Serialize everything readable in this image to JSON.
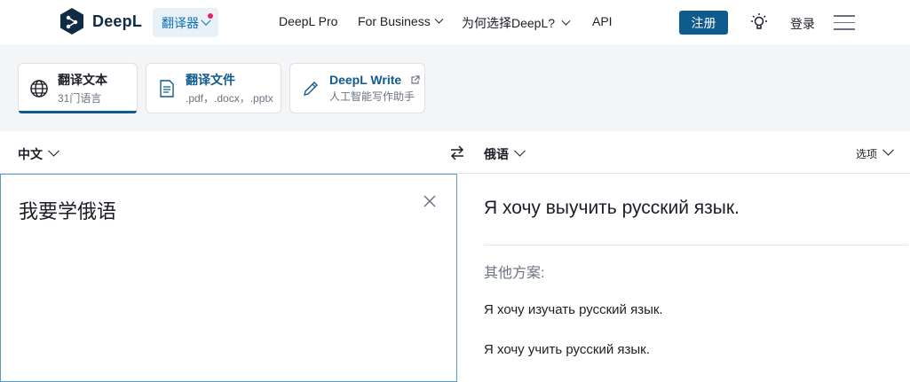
{
  "header": {
    "logo_text": "DeepL",
    "translator_label": "翻译器",
    "nav": [
      "DeepL Pro",
      "For Business",
      "为何选择DeepL?",
      "API"
    ],
    "signup_label": "注册",
    "login_label": "登录",
    "accent_color": "#0f5b8d"
  },
  "modes": [
    {
      "title": "翻译文本",
      "subtitle": "31门语言",
      "icon": "globe-icon"
    },
    {
      "title": "翻译文件",
      "subtitle": ".pdf，.docx，.pptx",
      "icon": "document-icon"
    },
    {
      "title": "DeepL Write",
      "subtitle": "人工智能写作助手",
      "icon": "pen-icon"
    }
  ],
  "languages": {
    "source": "中文",
    "target": "俄语",
    "options_label": "选项"
  },
  "source": {
    "text": "我要学俄语"
  },
  "target": {
    "text": "Я хочу выучить русский язык.",
    "alternatives_label": "其他方案:",
    "alternatives": [
      "Я хочу изучать русский язык.",
      "Я хочу учить русский язык."
    ]
  }
}
